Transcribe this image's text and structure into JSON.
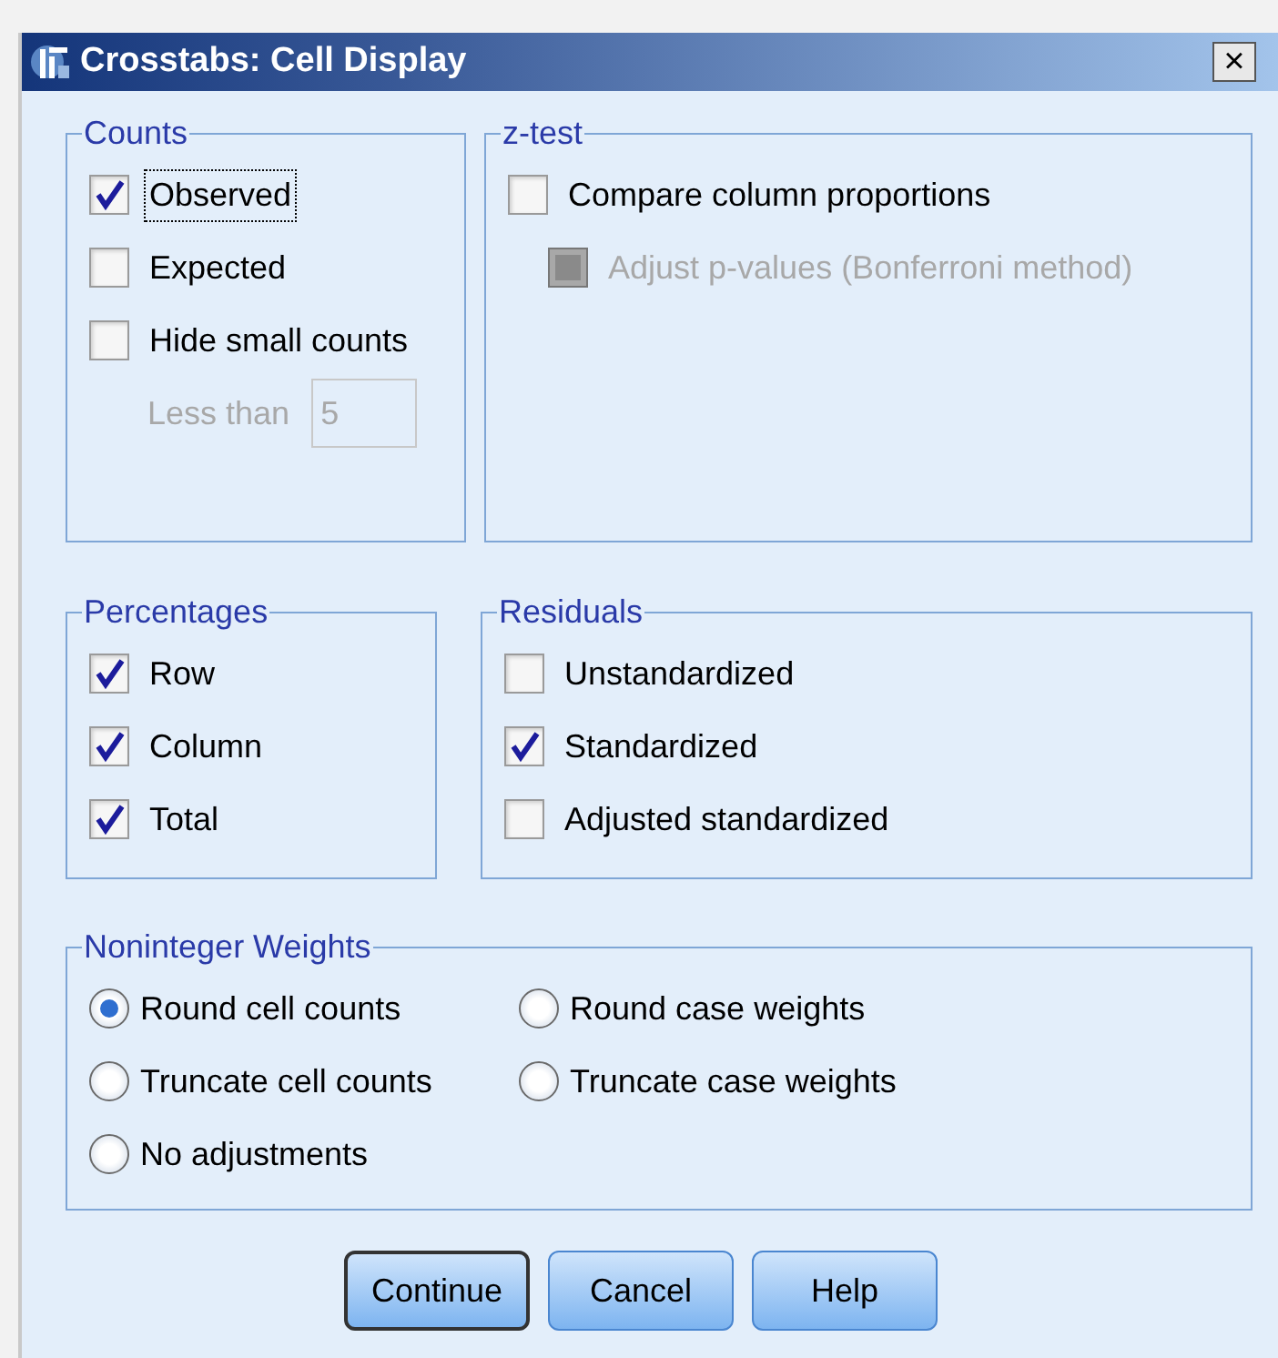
{
  "window": {
    "title": "Crosstabs: Cell Display",
    "close": "×"
  },
  "counts": {
    "title": "Counts",
    "items": [
      {
        "label": "Observed",
        "checked": true,
        "focused": true
      },
      {
        "label": "Expected",
        "checked": false,
        "focused": false
      },
      {
        "label": "Hide small counts",
        "checked": false,
        "focused": false
      }
    ],
    "less_than": {
      "label": "Less than",
      "value": "5",
      "disabled": true
    }
  },
  "z_test": {
    "title": "z-test",
    "items": [
      {
        "label": "Compare column proportions",
        "checked": false,
        "disabled": false
      },
      {
        "label": "Adjust p-values (Bonferroni method)",
        "checked": false,
        "disabled": true
      }
    ]
  },
  "percentages": {
    "title": "Percentages",
    "items": [
      {
        "label": "Row",
        "checked": true
      },
      {
        "label": "Column",
        "checked": true
      },
      {
        "label": "Total",
        "checked": true
      }
    ]
  },
  "residuals": {
    "title": "Residuals",
    "items": [
      {
        "label": "Unstandardized",
        "checked": false
      },
      {
        "label": "Standardized",
        "checked": true
      },
      {
        "label": "Adjusted standardized",
        "checked": false
      }
    ]
  },
  "noninteger_weights": {
    "title": "Noninteger Weights",
    "options": [
      {
        "label": "Round cell counts",
        "selected": true
      },
      {
        "label": "Round case weights",
        "selected": false
      },
      {
        "label": "Truncate cell counts",
        "selected": false
      },
      {
        "label": "Truncate case weights",
        "selected": false
      },
      {
        "label": "No adjustments",
        "selected": false
      }
    ]
  },
  "buttons": [
    {
      "label": "Continue",
      "default": true
    },
    {
      "label": "Cancel",
      "default": false
    },
    {
      "label": "Help",
      "default": false
    }
  ]
}
